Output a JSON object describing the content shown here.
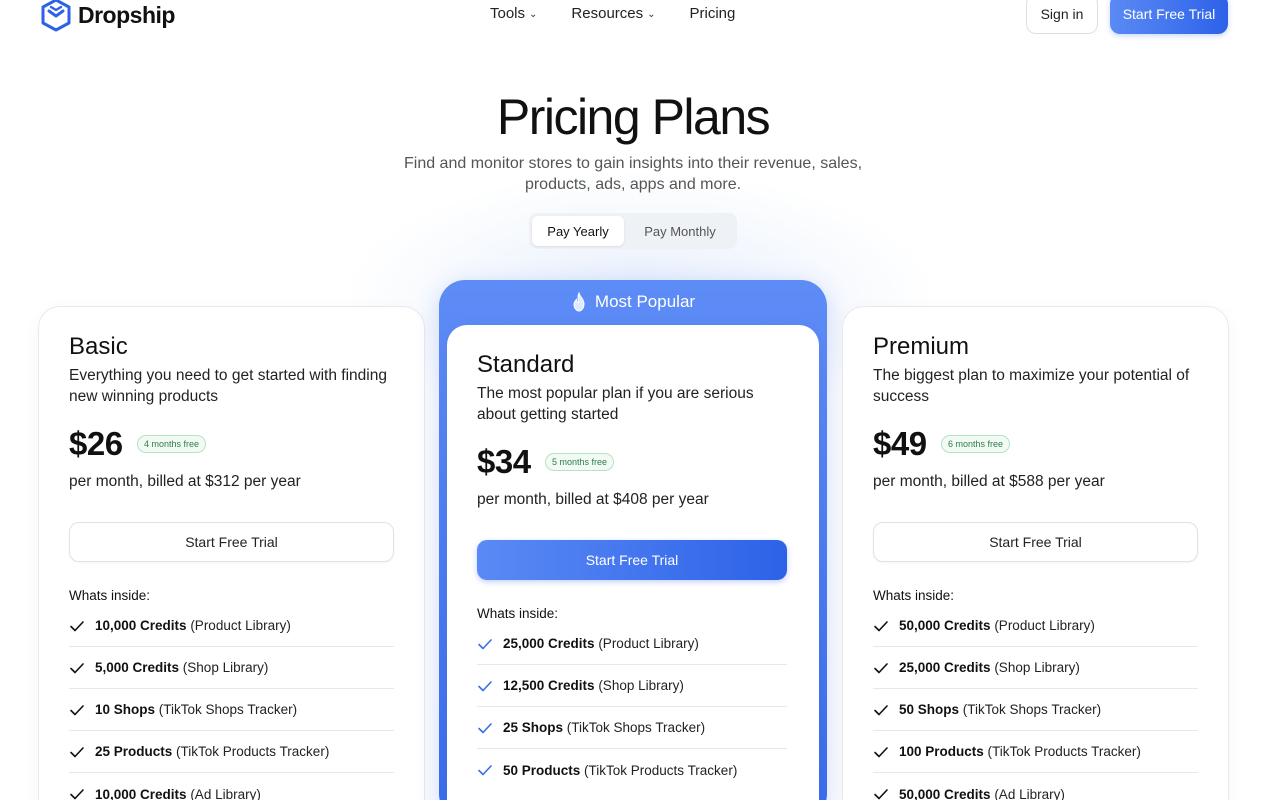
{
  "brand": {
    "name": "Dropship"
  },
  "nav": {
    "items": [
      {
        "label": "Tools",
        "has_dropdown": true
      },
      {
        "label": "Resources",
        "has_dropdown": true
      },
      {
        "label": "Pricing",
        "has_dropdown": false
      }
    ],
    "sign_in": "Sign in",
    "start_trial": "Start Free Trial"
  },
  "hero": {
    "title": "Pricing Plans",
    "subtitle_line1": "Find and monitor stores to gain insights into their revenue, sales,",
    "subtitle_line2": "products, ads, apps and more."
  },
  "billing_toggle": {
    "selected": "Pay Yearly",
    "options": [
      "Pay Yearly",
      "Pay Monthly"
    ]
  },
  "popular_label": "Most Popular",
  "colors": {
    "accent": "#2d62e8",
    "accent_light": "#5b8af5",
    "badge_green": "#2e7a4a"
  },
  "plans": [
    {
      "name": "Basic",
      "description": "Everything you need to get started with finding new winning products",
      "price": "$26",
      "badge": "4 months free",
      "billed": "per month, billed at $312 per year",
      "cta": "Start Free Trial",
      "inside_label": "Whats inside:",
      "features": [
        {
          "bold": "10,000 Credits",
          "rest": " (Product Library)"
        },
        {
          "bold": "5,000 Credits",
          "rest": " (Shop Library)"
        },
        {
          "bold": "10 Shops",
          "rest": " (TikTok Shops Tracker)"
        },
        {
          "bold": "25 Products",
          "rest": " (TikTok Products Tracker)"
        },
        {
          "bold": "10,000 Credits",
          "rest": " (Ad Library)"
        }
      ]
    },
    {
      "name": "Standard",
      "description": "The most popular plan if you are serious about getting started",
      "price": "$34",
      "badge": "5 months free",
      "billed": "per month, billed at $408 per year",
      "cta": "Start Free Trial",
      "inside_label": "Whats inside:",
      "features": [
        {
          "bold": "25,000 Credits",
          "rest": " (Product Library)"
        },
        {
          "bold": "12,500 Credits",
          "rest": " (Shop Library)"
        },
        {
          "bold": "25 Shops",
          "rest": " (TikTok Shops Tracker)"
        },
        {
          "bold": "50 Products",
          "rest": " (TikTok Products Tracker)"
        }
      ]
    },
    {
      "name": "Premium",
      "description": "The biggest plan to maximize your potential of success",
      "price": "$49",
      "badge": "6 months free",
      "billed": "per month, billed at $588 per year",
      "cta": "Start Free Trial",
      "inside_label": "Whats inside:",
      "features": [
        {
          "bold": "50,000 Credits",
          "rest": " (Product Library)"
        },
        {
          "bold": "25,000 Credits",
          "rest": " (Shop Library)"
        },
        {
          "bold": "50 Shops",
          "rest": " (TikTok Shops Tracker)"
        },
        {
          "bold": "100 Products",
          "rest": " (TikTok Products Tracker)"
        },
        {
          "bold": "50,000 Credits",
          "rest": " (Ad Library)"
        }
      ]
    }
  ]
}
